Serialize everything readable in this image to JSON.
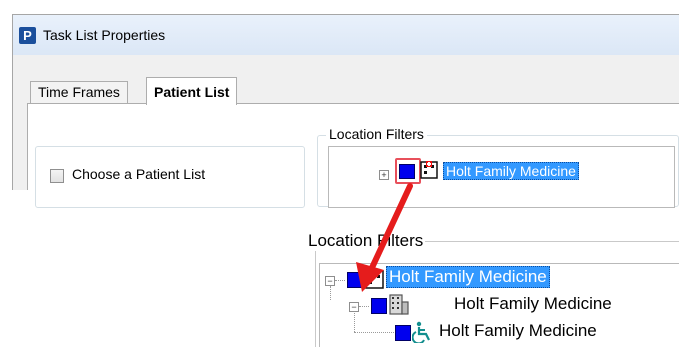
{
  "window": {
    "app_icon_letter": "P",
    "title": "Task List Properties"
  },
  "tabs": [
    {
      "label": "Time Frames",
      "active": false
    },
    {
      "label": "Patient List",
      "active": true
    }
  ],
  "patient_list": {
    "checkbox_label": "Choose a Patient List",
    "checked": false
  },
  "location_filters": {
    "group_label": "Location Filters",
    "collapsed_node": {
      "label": "Holt Family Medicine",
      "selected": true
    }
  },
  "expanded_view": {
    "group_label": "Location Filters",
    "tree": [
      {
        "label": "Holt Family Medicine",
        "level": 0,
        "selected": true,
        "icon": "medical-building-icon"
      },
      {
        "label": "Holt Family Medicine",
        "level": 1,
        "selected": false,
        "icon": "office-building-icon"
      },
      {
        "label": "Holt Family Medicine",
        "level": 2,
        "selected": false,
        "icon": "wheelchair-icon"
      }
    ]
  },
  "colors": {
    "selection": "#3399ff",
    "node_square": "#0000ee",
    "highlight_box": "#e8505b",
    "arrow": "#e51c1c",
    "wheelchair": "#138e8e"
  }
}
